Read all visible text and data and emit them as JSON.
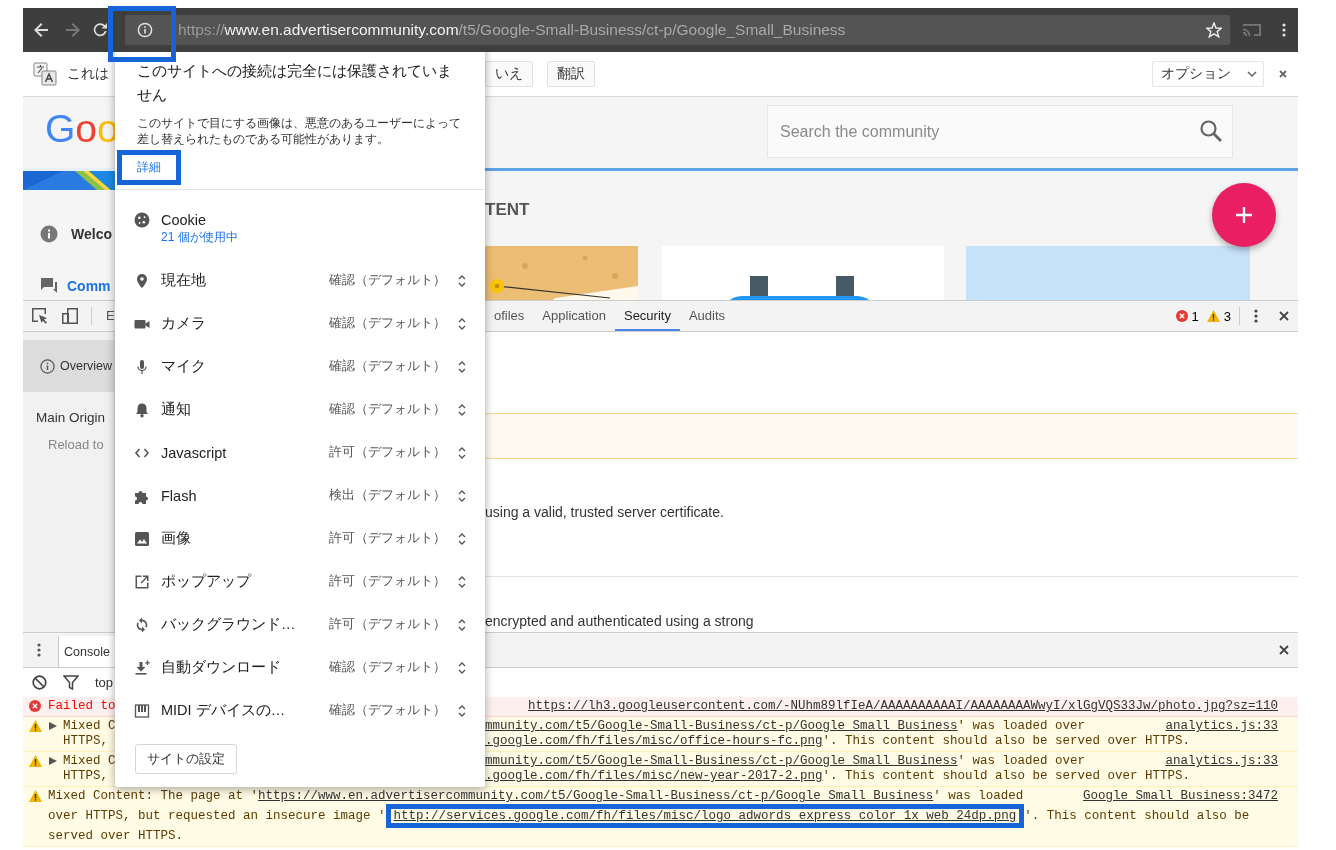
{
  "toolbar": {
    "url": "https://www.en.advertisercommunity.com/t5/Google-Small-Business/ct-p/Google_Small_Business",
    "forward_disabled": true,
    "site_info_highlighted": true
  },
  "translate_bar": {
    "message": "これは",
    "buttons": [
      "いえ",
      "翻訳"
    ],
    "options": "オプション"
  },
  "page": {
    "logo": "Goo",
    "search": {
      "placeholder": "Search the community"
    },
    "nav": [
      {
        "label": "Welco",
        "selected": false
      },
      {
        "label": "Comm",
        "selected": true
      }
    ],
    "section_heading": "TENT"
  },
  "devtools": {
    "tabs": [
      {
        "label": "E",
        "selected": false
      },
      {
        "label": "ofiles",
        "selected": false
      },
      {
        "label": "Application",
        "selected": false
      },
      {
        "label": "Security",
        "selected": true
      },
      {
        "label": "Audits",
        "selected": false
      }
    ],
    "error_count": "1",
    "warning_count": "3",
    "sidebar": {
      "items": [
        {
          "label": "Overview",
          "selected": true
        }
      ],
      "heading": "Main Origin",
      "note": "Reload to"
    },
    "content_lines": [
      "using a valid, trusted server certificate.",
      "encrypted and authenticated using a strong"
    ]
  },
  "console": {
    "tab": "Console",
    "context": "top",
    "messages": [
      {
        "kind": "error",
        "left": [
          "Failed to"
        ],
        "source": "https://lh3.googleusercontent.com/-NUhm89lfIeA/AAAAAAAAAAI/AAAAAAAAWwyI/xlGgVQS33Jw/photo.jpg?sz=110"
      },
      {
        "kind": "warning",
        "expandable": true,
        "left": [
          "Mixed C",
          "HTTPS,"
        ],
        "source": "analytics.js:33",
        "right": [
          [
            {
              "text": "mmunity.com/t5/Google-Small-Business/ct-p/Google_Small_Business",
              "link": true
            },
            {
              "text": "' was loaded over"
            }
          ],
          [
            {
              "text": ".google.com/fh/files/misc/office-hours-fc.png",
              "link": true
            },
            {
              "text": "'. This content should also be served over HTTPS."
            }
          ]
        ]
      },
      {
        "kind": "warning",
        "expandable": true,
        "left": [
          "Mixed C",
          "HTTPS,"
        ],
        "source": "analytics.js:33",
        "right": [
          [
            {
              "text": "mmunity.com/t5/Google-Small-Business/ct-p/Google_Small_Business",
              "link": true
            },
            {
              "text": "' was loaded over"
            }
          ],
          [
            {
              "text": ".google.com/fh/files/misc/new-year-2017-2.png",
              "link": true
            },
            {
              "text": "'. This content should also be served over HTTPS."
            }
          ]
        ]
      },
      {
        "kind": "warning",
        "expandable": false,
        "source": "Google_Small_Business:3472",
        "lines": [
          [
            {
              "text": "Mixed Content: The page at '"
            },
            {
              "text": "https://www.en.advertisercommunity.com/t5/Google-Small-Business/ct-p/Google_Small_Business",
              "link": true
            },
            {
              "text": "' was loaded"
            }
          ],
          [
            {
              "text": "over HTTPS, but requested an insecure image '"
            },
            {
              "text": "http://services.google.com/fh/files/misc/logo_adwords_express_color_1x_web_24dp.png",
              "link": true,
              "highlighted": true
            },
            {
              "text": "'. This content should also be"
            }
          ],
          [
            {
              "text": "served over HTTPS."
            }
          ]
        ]
      }
    ]
  },
  "popup": {
    "title": "このサイトへの接続は完全には保護されていません",
    "description": "このサイトで目にする画像は、悪意のあるユーザーによって差し替えられたものである可能性があります。",
    "details_link": "詳細",
    "details_highlighted": true,
    "cookie": {
      "label": "Cookie",
      "usage": "21 個が使用中"
    },
    "permissions": [
      {
        "label": "現在地",
        "value": "確認（デフォルト）"
      },
      {
        "label": "カメラ",
        "value": "確認（デフォルト）"
      },
      {
        "label": "マイク",
        "value": "確認（デフォルト）"
      },
      {
        "label": "通知",
        "value": "確認（デフォルト）"
      },
      {
        "label": "Javascript",
        "value": "許可（デフォルト）"
      },
      {
        "label": "Flash",
        "value": "検出（デフォルト）"
      },
      {
        "label": "画像",
        "value": "許可（デフォルト）"
      },
      {
        "label": "ポップアップ",
        "value": "許可（デフォルト）"
      },
      {
        "label": "バックグラウンド…",
        "value": "許可（デフォルト）"
      },
      {
        "label": "自動ダウンロード",
        "value": "確認（デフォルト）"
      },
      {
        "label": "MIDI デバイスの…",
        "value": "確認（デフォルト）"
      }
    ],
    "settings_button": "サイトの設定"
  }
}
